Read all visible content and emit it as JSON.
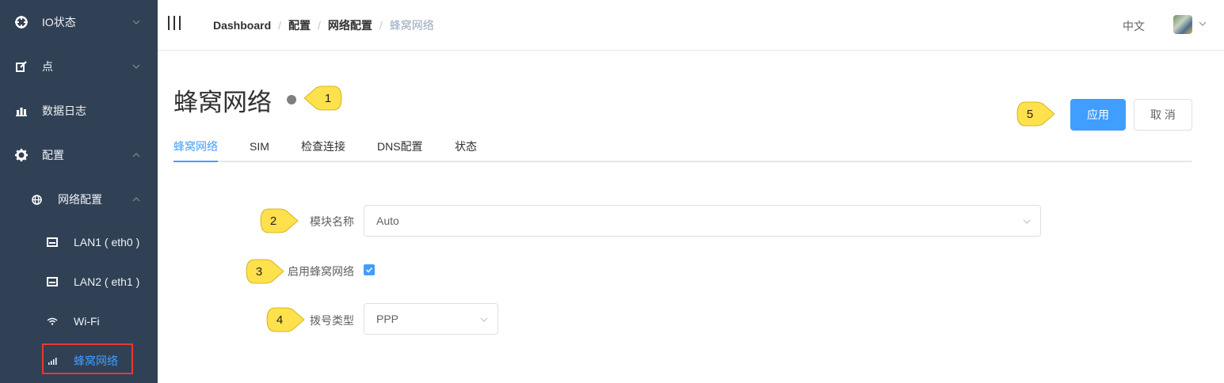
{
  "sidebar": {
    "items": [
      {
        "label": "IO状态",
        "icon": "crosshair-icon"
      },
      {
        "label": "点",
        "icon": "edit-icon"
      },
      {
        "label": "数据日志",
        "icon": "bar-chart-icon"
      },
      {
        "label": "配置",
        "icon": "gear-icon"
      },
      {
        "label": "网络配置",
        "icon": "globe-icon"
      },
      {
        "label": "LAN1 ( eth0 )",
        "icon": "ethernet-icon"
      },
      {
        "label": "LAN2 ( eth1 )",
        "icon": "ethernet-icon"
      },
      {
        "label": "Wi-Fi",
        "icon": "wifi-icon"
      },
      {
        "label": "蜂窝网络",
        "icon": "signal-icon"
      }
    ]
  },
  "header": {
    "breadcrumbs": [
      "Dashboard",
      "配置",
      "网络配置",
      "蜂窝网络"
    ],
    "separator": "/",
    "language": "中文"
  },
  "main": {
    "title": "蜂窝网络",
    "tabs": [
      "蜂窝网络",
      "SIM",
      "检查连接",
      "DNS配置",
      "状态"
    ],
    "apply_label": "应用",
    "cancel_label": "取 消",
    "form": {
      "module_label": "模块名称",
      "module_value": "Auto",
      "enable_label": "启用蜂窝网络",
      "enable_checked": true,
      "dial_label": "拨号类型",
      "dial_value": "PPP"
    }
  },
  "callouts": [
    "1",
    "2",
    "3",
    "4",
    "5"
  ],
  "colors": {
    "sidebar_bg": "#304156",
    "accent": "#409eff",
    "highlight_box": "#e8392e",
    "callout": "#ffe04d"
  }
}
